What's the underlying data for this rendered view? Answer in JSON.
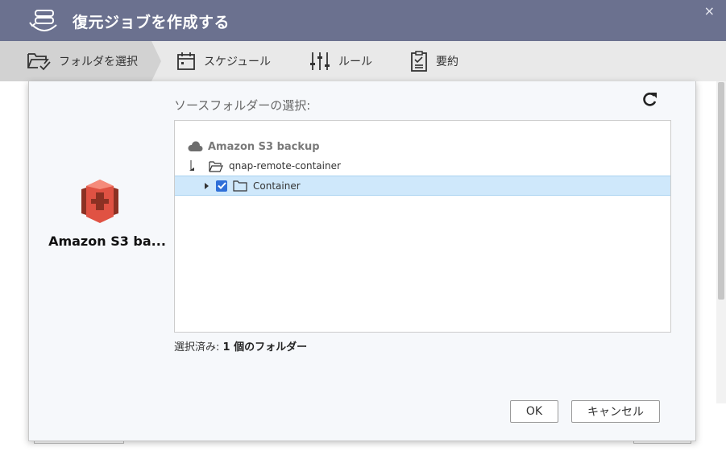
{
  "window": {
    "title": "復元ジョブを作成する",
    "close_label": "×"
  },
  "steps": [
    {
      "label": "フォルダを選択",
      "icon": "folder-check-icon",
      "active": true
    },
    {
      "label": "スケジュール",
      "icon": "calendar-icon",
      "active": false
    },
    {
      "label": "ルール",
      "icon": "sliders-icon",
      "active": false
    },
    {
      "label": "要約",
      "icon": "clipboard-icon",
      "active": false
    }
  ],
  "storage": {
    "name": "Amazon S3 ba...",
    "logo_icon": "amazon-s3-logo-icon",
    "logo_color": "#e05243"
  },
  "source": {
    "label": "ソースフォルダーの選択:",
    "tree": {
      "root": {
        "label": "Amazon S3 backup",
        "icon": "cloud-icon"
      },
      "folder": {
        "label": "qnap-remote-container",
        "icon": "folder-open-icon"
      },
      "child": {
        "label": "Container",
        "icon": "folder-icon",
        "checked": true
      }
    },
    "summary_prefix": "選択済み: ",
    "summary_value": "1 個のフォルダー"
  },
  "buttons": {
    "ok": "OK",
    "cancel": "キャンセル"
  },
  "colors": {
    "title_bar": "#6b718f",
    "step_bar": "#e9e9e9",
    "step_active": "#d2d2d2",
    "selected_row": "#cfe8fb",
    "checkbox": "#2f6fd8"
  }
}
